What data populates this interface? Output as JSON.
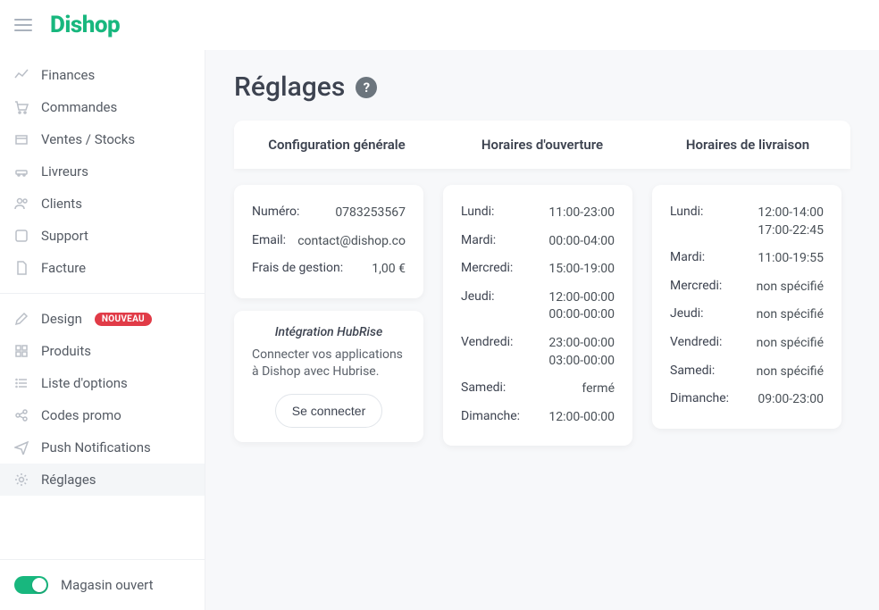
{
  "brand": "Dishop",
  "page": {
    "title": "Réglages"
  },
  "nav": {
    "group1": [
      {
        "label": "Finances"
      },
      {
        "label": "Commandes"
      },
      {
        "label": "Ventes / Stocks"
      },
      {
        "label": "Livreurs"
      },
      {
        "label": "Clients"
      },
      {
        "label": "Support"
      },
      {
        "label": "Facture"
      }
    ],
    "group2": [
      {
        "label": "Design",
        "badge": "NOUVEAU"
      },
      {
        "label": "Produits"
      },
      {
        "label": "Liste d'options"
      },
      {
        "label": "Codes promo"
      },
      {
        "label": "Push Notifications"
      },
      {
        "label": "Réglages",
        "active": true
      }
    ]
  },
  "store_toggle": {
    "label": "Magasin ouvert",
    "on": true
  },
  "tabs": [
    {
      "label": "Configuration générale"
    },
    {
      "label": "Horaires d'ouverture"
    },
    {
      "label": "Horaires de livraison"
    }
  ],
  "config": {
    "number_label": "Numéro:",
    "number_value": "0783253567",
    "email_label": "Email:",
    "email_value": "contact@dishop.co",
    "fee_label": "Frais de gestion:",
    "fee_value": "1,00 €"
  },
  "integration": {
    "title": "Intégration HubRise",
    "desc": "Connecter vos applications à Dishop avec Hubrise.",
    "button": "Se connecter"
  },
  "opening_hours": [
    {
      "day": "Lundi:",
      "value": "11:00-23:00"
    },
    {
      "day": "Mardi:",
      "value": "00:00-04:00"
    },
    {
      "day": "Mercredi:",
      "value": "15:00-19:00"
    },
    {
      "day": "Jeudi:",
      "value": "12:00-00:00\n00:00-00:00"
    },
    {
      "day": "Vendredi:",
      "value": "23:00-00:00\n03:00-00:00"
    },
    {
      "day": "Samedi:",
      "value": "fermé"
    },
    {
      "day": "Dimanche:",
      "value": "12:00-00:00"
    }
  ],
  "delivery_hours": [
    {
      "day": "Lundi:",
      "value": "12:00-14:00\n17:00-22:45"
    },
    {
      "day": "Mardi:",
      "value": "11:00-19:55"
    },
    {
      "day": "Mercredi:",
      "value": "non spécifié"
    },
    {
      "day": "Jeudi:",
      "value": "non spécifié"
    },
    {
      "day": "Vendredi:",
      "value": "non spécifié"
    },
    {
      "day": "Samedi:",
      "value": "non spécifié"
    },
    {
      "day": "Dimanche:",
      "value": "09:00-23:00"
    }
  ]
}
